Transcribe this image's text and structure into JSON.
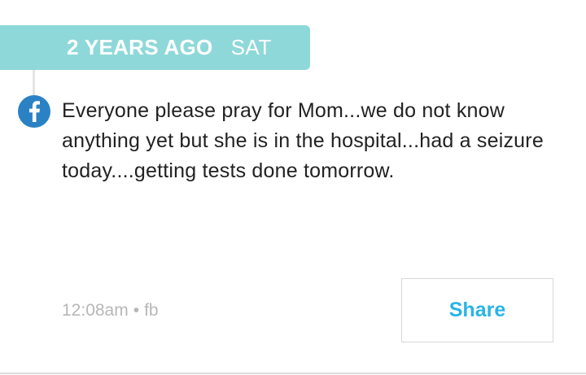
{
  "header": {
    "time_ago": "2 YEARS AGO",
    "weekday": "SAT"
  },
  "post": {
    "source_icon": "facebook-icon",
    "text": "Everyone please pray for Mom...we do not know anything yet but she is in the hospital...had a seizure today....getting tests done tomorrow.",
    "time": "12:08am",
    "separator": "•",
    "source": "fb"
  },
  "actions": {
    "share_label": "Share"
  },
  "colors": {
    "header_bg": "#8fd8d9",
    "facebook_blue": "#2a82c4",
    "share_text": "#2bb4e6",
    "meta_text": "#b7b7b7"
  }
}
